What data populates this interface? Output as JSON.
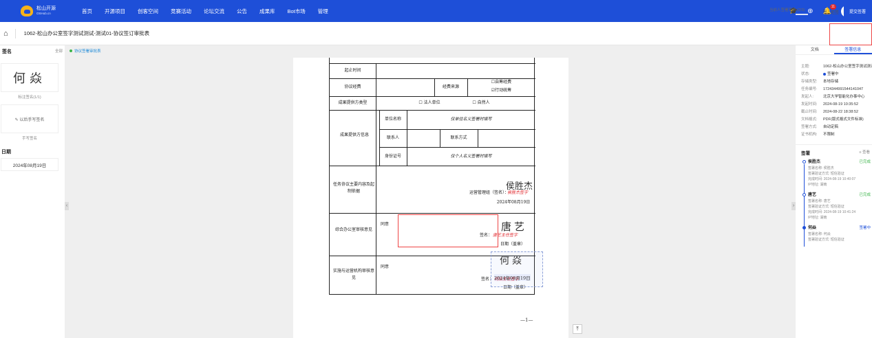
{
  "topnav": {
    "logo_name": "松山开源",
    "logo_sub": "OSHub.cn",
    "items": [
      "首页",
      "开源项目",
      "创客空间",
      "竞赛活动",
      "论坛交流",
      "公告",
      "成果库",
      "Bot市场",
      "管理"
    ],
    "notification_count": "11"
  },
  "docbar": {
    "title": "1062-松山办公室签字测试测试-测试01-协议签订审批表",
    "progress_label": "当前人签署完毕 (2/3)",
    "progress_fraction": 0.67,
    "reject_label": "拒签",
    "sign_label": "提交签署"
  },
  "left": {
    "title": "签名",
    "all_label": "全部",
    "signature_name": "何焱",
    "signature_caption": "标注签名(1/1)",
    "add_handwrite_label": "✎ 以后手写签名",
    "handwrite_caption": "手写签名",
    "date_title": "日期",
    "date_value": "2024年08月19日"
  },
  "viewer": {
    "field_hint": "协议签署审批表",
    "page_number": "—1—"
  },
  "form": {
    "r_period": "起止时间",
    "r_fee": "协议经费",
    "r_fee_source": "经费来源",
    "r_fee_opt1": "☐自筹经费",
    "r_fee_opt2": "☑行动统筹",
    "r_provider_type": "成果提供方类型",
    "r_opt_legal": "☐ 法人单位",
    "r_opt_person": "☐ 自然人",
    "r_provider_info": "成果提供方信息",
    "r_unit_name": "单位名称",
    "r_unit_hint": "仅单位名义签署时填写",
    "r_contact": "联系人",
    "r_contact_method": "联系方式",
    "r_id_no": "身份证号",
    "r_id_hint": "仅个人名义签署时填写",
    "r_main_content": "任务协议主要内容及起制依据",
    "r_main_signer": "侯胜杰",
    "r_main_sign_label": "运营管理组（签名）：",
    "r_main_sign_red": "侯胜杰签字",
    "r_main_date": "2024年08月19日",
    "r_office_opinion": "综合办公室审核意见",
    "r_agree": "同意",
    "r_office_signer": "唐艺",
    "r_sign_label": "签名：",
    "r_office_sign_red": "唐艺主任签字",
    "r_date_label": "日期（盖章）",
    "r_impl_opinion": "实施与运营机构审核意见",
    "r_impl_agree": "同意",
    "r_impl_sign_red": "何焱主任签字",
    "r_impl_date_label": "日期（盖章）",
    "placed_signature": "何焱",
    "placed_date": "2024年08月19日"
  },
  "right": {
    "tab_doc": "文档",
    "tab_sign": "签署信息",
    "info": [
      {
        "label": "主题:",
        "value": "1062-松山办公室签字测试测试-测试01-协议签订审批表"
      },
      {
        "label": "状态:",
        "value": "签署中"
      },
      {
        "label": "存储类型:",
        "value": "本地存储"
      },
      {
        "label": "任务编号:",
        "value": "1724344991544141047"
      },
      {
        "label": "发起人:",
        "value": "北京大学智能化办事中心"
      },
      {
        "label": "发起时间:",
        "value": "2024-08-19 10:35:52"
      },
      {
        "label": "截止时间:",
        "value": "2024-08-22 18:38:52"
      },
      {
        "label": "文档格式:",
        "value": "PDF(版式格式文件标准)"
      },
      {
        "label": "签署方式:",
        "value": "自动定稿"
      },
      {
        "label": "证书机构:",
        "value": "不限制"
      }
    ],
    "sig_title": "签署",
    "sig_view": "≡ 查看",
    "signers": [
      {
        "name": "侯胜杰",
        "status": "已完成",
        "status_color": "#3bb54a",
        "lines": [
          "签署名称: 侯胜杰",
          "签署验证方式: 短信验证",
          "完成时间: 2024-08-19 10:40:07",
          "IP地址: 湖南"
        ]
      },
      {
        "name": "唐艺",
        "status": "已完成",
        "status_color": "#3bb54a",
        "lines": [
          "签署名称: 唐艺",
          "签署验证方式: 短信验证",
          "完成时间: 2024-08-19 10:41:24",
          "IP地址: 湖南"
        ]
      },
      {
        "name": "何焱",
        "status": "签署中",
        "status_color": "#1e4fd8",
        "lines": [
          "签署名称: 何焱",
          "签署验证方式: 短信验证"
        ]
      }
    ]
  },
  "colors": {
    "brand": "#1e4fd8",
    "danger": "#e0262b",
    "success": "#3bb54a"
  }
}
